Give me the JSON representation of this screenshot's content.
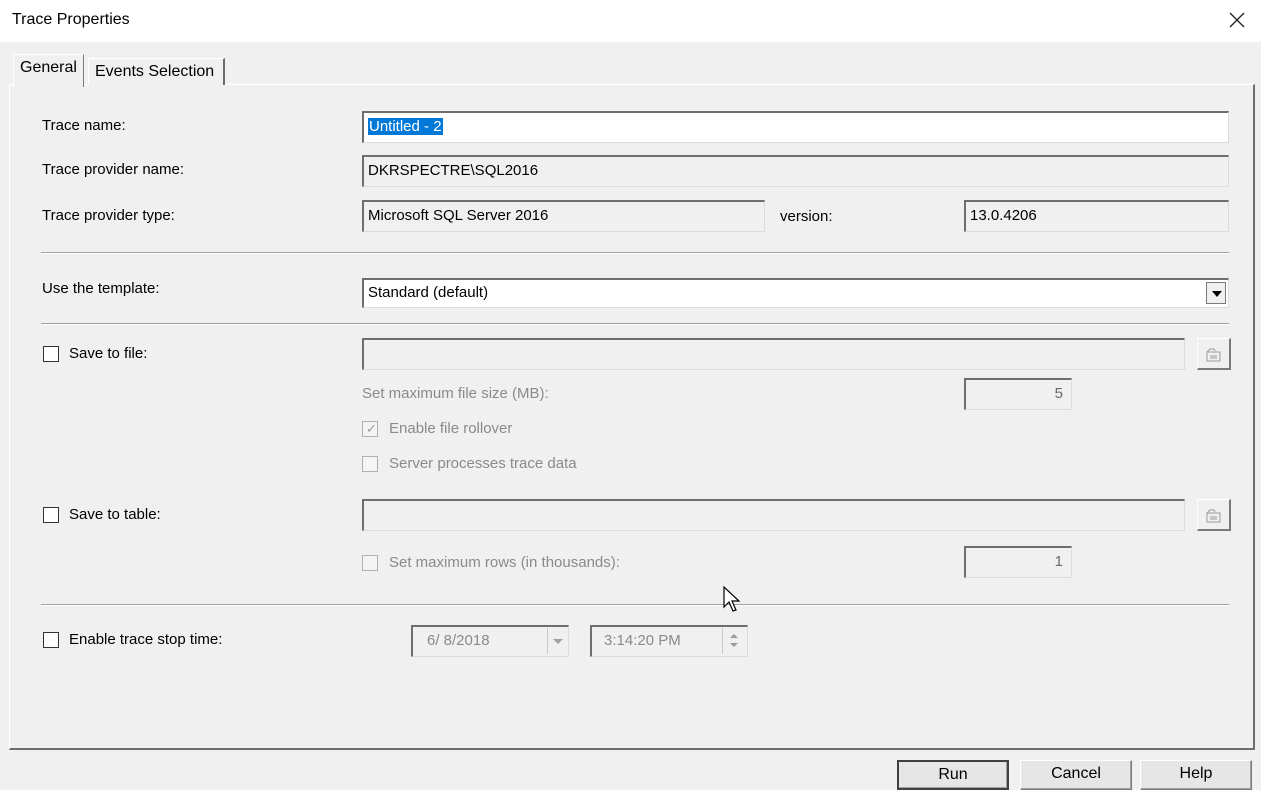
{
  "window": {
    "title": "Trace Properties"
  },
  "tabs": [
    {
      "label": "General",
      "active": true
    },
    {
      "label": "Events Selection",
      "active": false
    }
  ],
  "general": {
    "trace_name_label": "Trace name:",
    "trace_name_value": "Untitled - 2",
    "provider_name_label": "Trace provider name:",
    "provider_name_value": "DKRSPECTRE\\SQL2016",
    "provider_type_label": "Trace provider type:",
    "provider_type_value": "Microsoft SQL Server 2016",
    "version_label": "version:",
    "version_value": "13.0.4206",
    "template_label": "Use the template:",
    "template_value": "Standard (default)",
    "save_to_file_label": "Save to file:",
    "save_to_file_checked": false,
    "save_to_file_path": "",
    "max_file_size_label": "Set maximum file size (MB):",
    "max_file_size_value": "5",
    "enable_rollover_label": "Enable file rollover",
    "enable_rollover_checked": true,
    "server_processes_label": "Server processes trace data",
    "server_processes_checked": false,
    "save_to_table_label": "Save to table:",
    "save_to_table_checked": false,
    "save_to_table_value": "",
    "max_rows_label": "Set maximum rows (in thousands):",
    "max_rows_checked": false,
    "max_rows_value": "1",
    "stop_time_label": "Enable trace stop time:",
    "stop_time_checked": false,
    "stop_date": "6/ 8/2018",
    "stop_time": "3:14:20 PM"
  },
  "buttons": {
    "run": "Run",
    "cancel": "Cancel",
    "help": "Help"
  },
  "colors": {
    "selection": "#0078d7",
    "background": "#f0f0f0",
    "disabled_text": "#8a8a8a"
  }
}
